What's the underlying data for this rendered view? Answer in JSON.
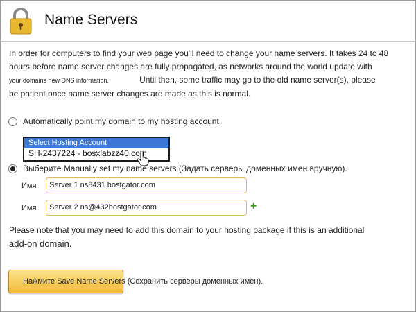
{
  "header": {
    "title": "Name Servers",
    "icon": "lock-icon"
  },
  "intro": {
    "line1": "In order for computers to find your web page you'll need to change your name servers. It takes 24 to 48",
    "line2": "hours before name server changes are fully propagated, as networks around the world update with",
    "line3a": "your domains new DNS information.",
    "line3b": "Until then, some traffic may go to the old name server(s), please",
    "line4": "be patient once name server changes are made as this is normal."
  },
  "options": {
    "auto_label": "Automatically point my domain to my hosting account",
    "auto_selected": false,
    "manual_label": "Выберите Manually set my name servers (Задать серверы доменных имен вручную).",
    "manual_selected": true
  },
  "hosting_dropdown": {
    "selected": "Select Hosting Account",
    "options": [
      "SH-2437224 - bosxlabzz40.com"
    ]
  },
  "servers": [
    {
      "label": "Имя",
      "value": "Server 1 ns8431 hostgator.com"
    },
    {
      "label": "Имя",
      "value": "Server 2 ns@432hostgator.com"
    }
  ],
  "add_server_symbol": "+",
  "note": {
    "line1": "Please note that you may need to add this domain to your hosting package if this is an additional",
    "line2": "add-on domain."
  },
  "save": {
    "label": "Нажмите Save Name Servers (Сохранить серверы доменных имен)."
  },
  "colors": {
    "button_gradient_top": "#fce38a",
    "button_gradient_bottom": "#f2bb3a",
    "input_border": "#e0b85a",
    "dropdown_highlight": "#3b78d8",
    "plus_green": "#3a9a1a"
  }
}
